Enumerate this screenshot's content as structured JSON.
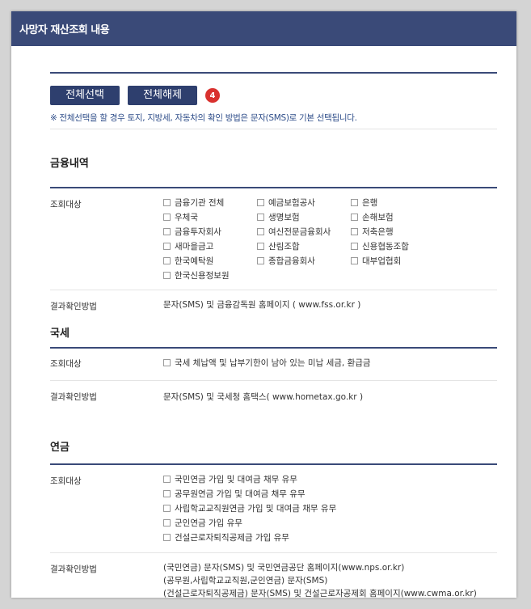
{
  "header": {
    "title": "사망자 재산조회 내용"
  },
  "actions": {
    "select_all": "전체선택",
    "deselect_all": "전체해제",
    "badge": "4",
    "notice": "※ 전체선택을 할 경우 토지, 지방세, 자동차의 확인 방법은 문자(SMS)로 기본 선택됩니다."
  },
  "finance": {
    "title": "금융내역",
    "target_label": "조회대상",
    "items": [
      "금융기관 전체",
      "예금보험공사",
      "은행",
      "우체국",
      "생명보험",
      "손해보험",
      "금융투자회사",
      "여신전문금융회사",
      "저축은행",
      "새마을금고",
      "산림조합",
      "신용협동조합",
      "한국예탁원",
      "종합금융회사",
      "대부업협회",
      "한국신용정보원"
    ],
    "result_label": "결과확인방법",
    "result_text": "문자(SMS) 및 금융감독원 홈페이지 ( www.fss.or.kr )"
  },
  "tax": {
    "title": "국세",
    "target_label": "조회대상",
    "item": "국세 체납액 및 납부기한이 남아 있는 미납 세금, 환급금",
    "result_label": "결과확인방법",
    "result_text": "문자(SMS) 및 국세청 홈택스( www.hometax.go.kr )"
  },
  "pension": {
    "title": "연금",
    "target_label": "조회대상",
    "items": [
      "국민연금 가입 및 대여금 채무 유무",
      "공무원연금 가입 및 대여금 채무 유무",
      "사립학교교직원연금 가입 및 대여금 채무 유무",
      "군인연금 가입 유무",
      "건설근로자퇴직공제금 가입 유무"
    ],
    "result_label": "결과확인방법",
    "result_lines": [
      "(국민연금) 문자(SMS) 및 국민연금공단 홈페이지(www.nps.or.kr)",
      "(공무원,사립학교교직원,군인연금) 문자(SMS)",
      "(건설근로자퇴직공제금) 문자(SMS) 및 건설근로자공제회 홈페이지(www.cwma.or.kr)"
    ]
  }
}
